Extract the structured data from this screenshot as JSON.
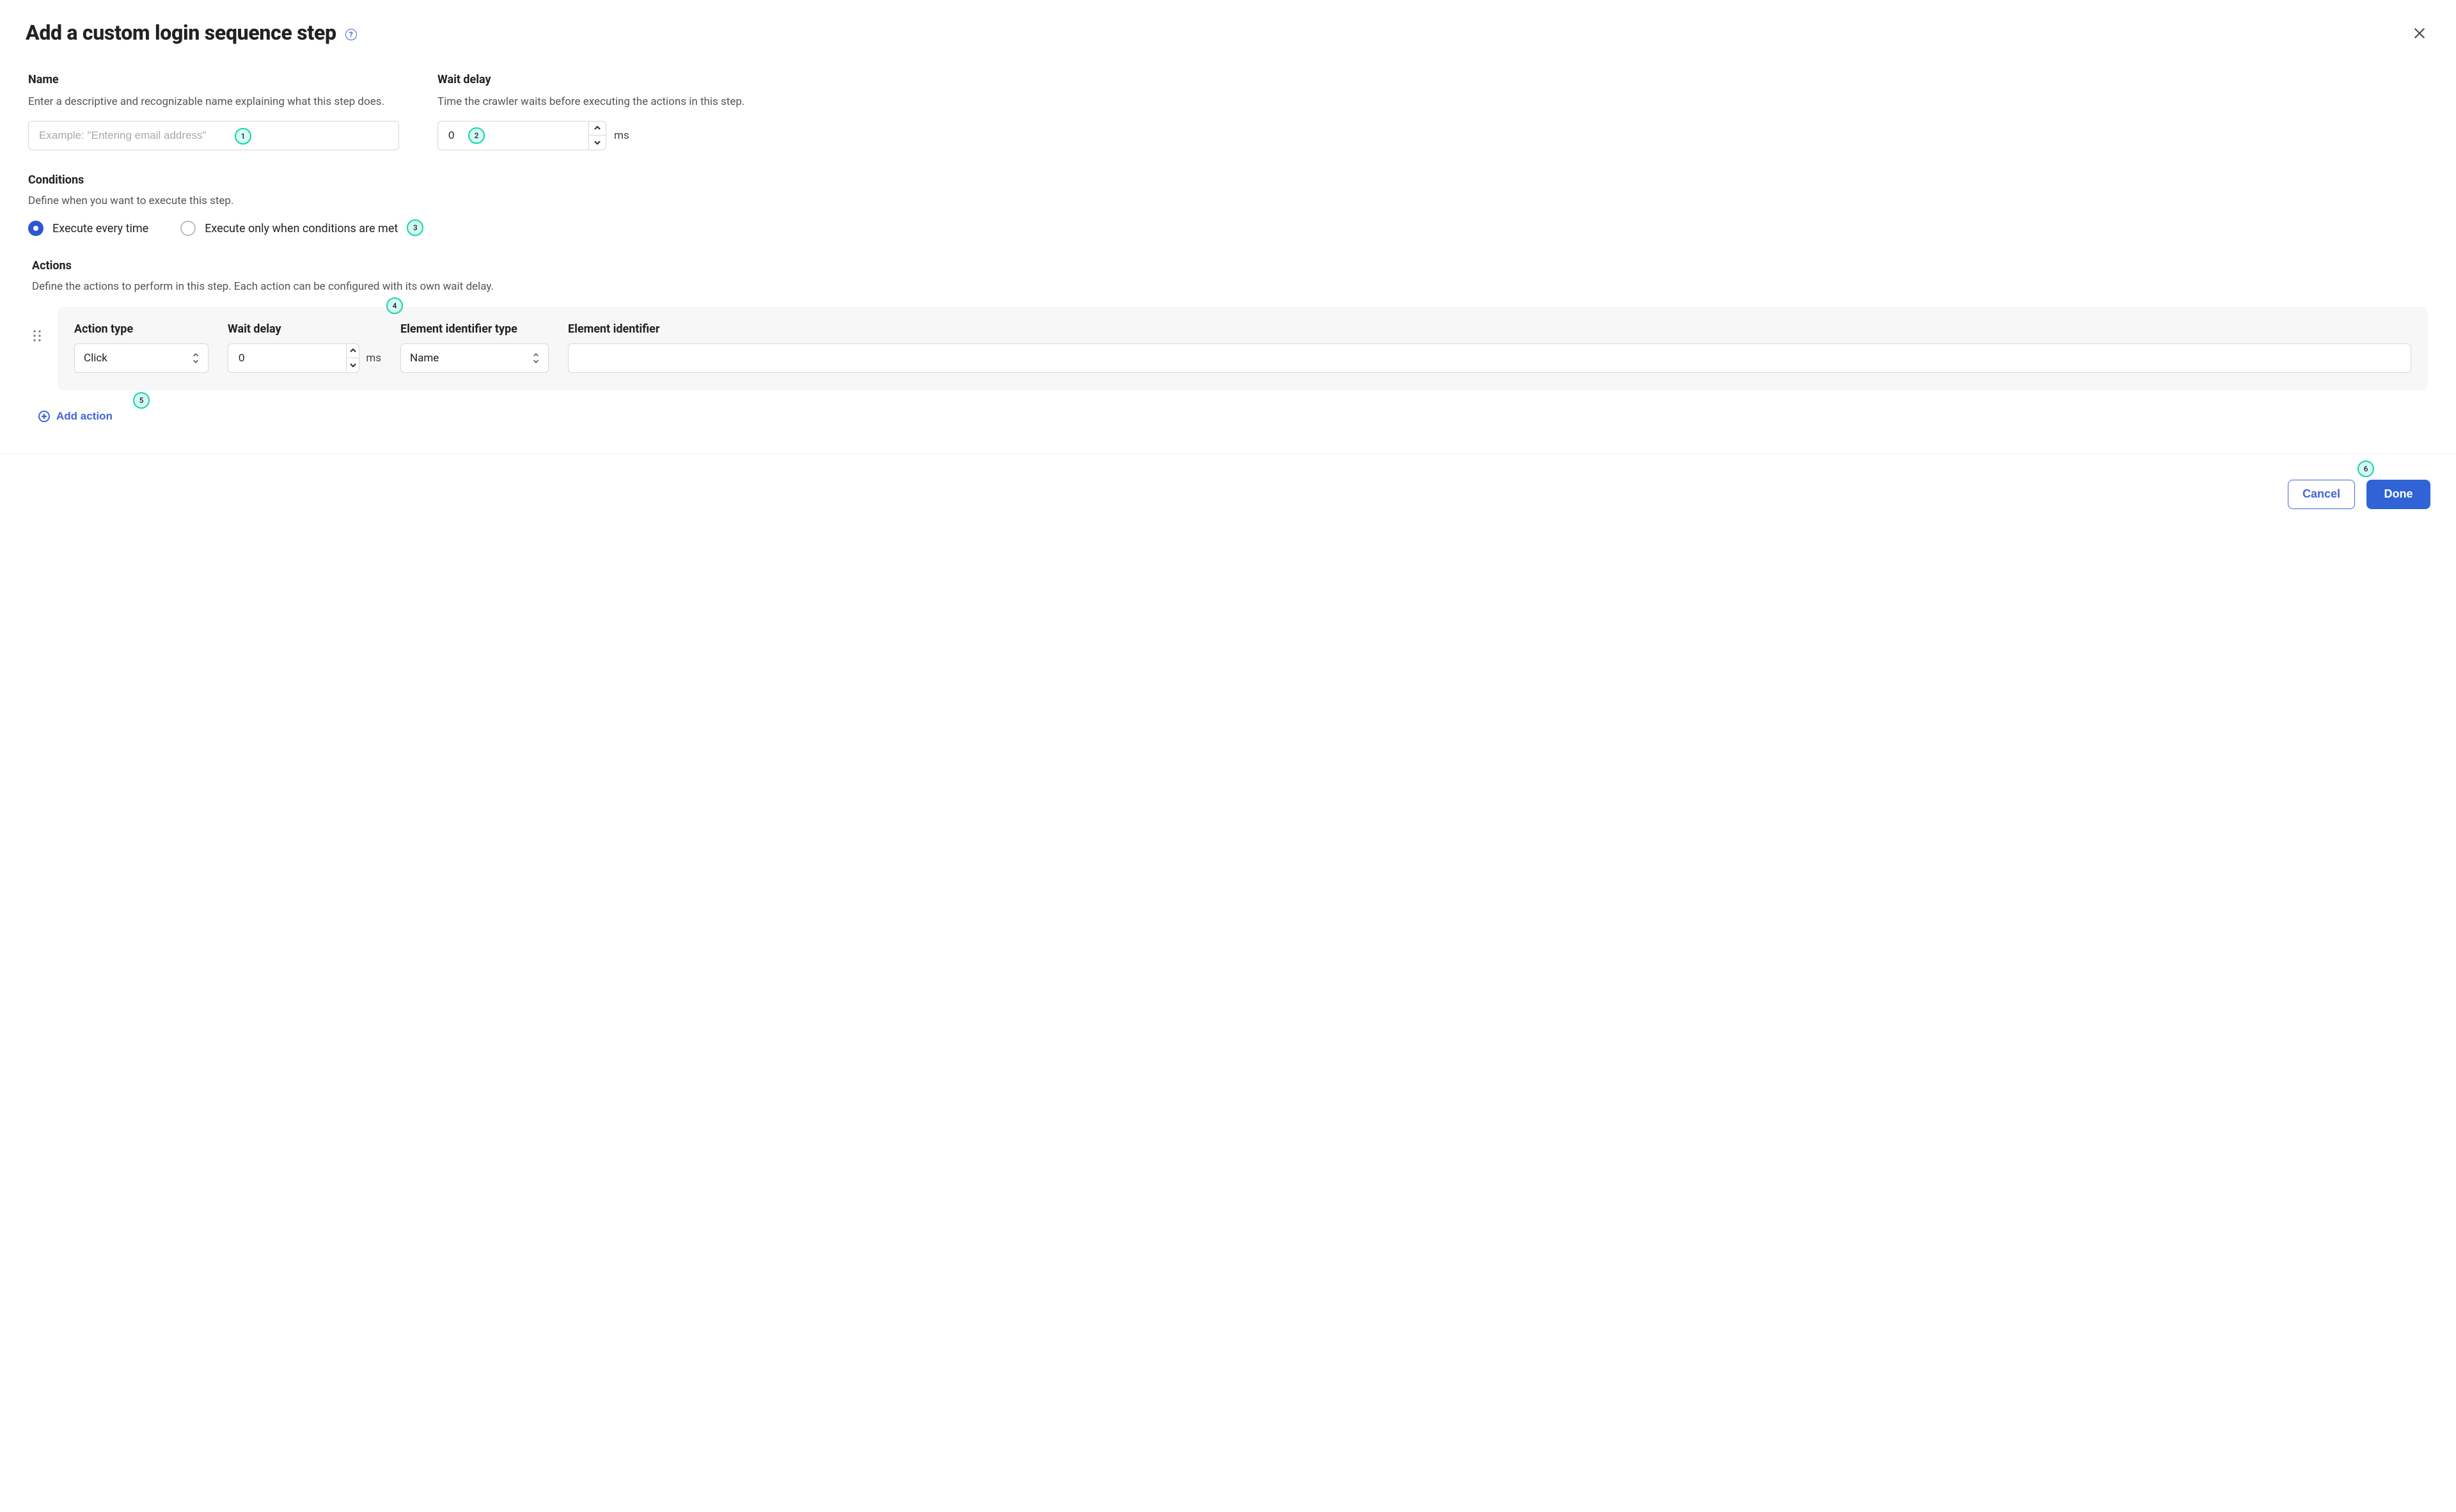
{
  "dialog": {
    "title": "Add a custom login sequence step"
  },
  "name": {
    "label": "Name",
    "hint": "Enter a descriptive and recognizable name explaining what this step does.",
    "placeholder": "Example: \"Entering email address\"",
    "value": ""
  },
  "wait_delay": {
    "label": "Wait delay",
    "hint": "Time the crawler waits before executing the actions in this step.",
    "value": "0",
    "unit": "ms"
  },
  "conditions": {
    "label": "Conditions",
    "hint": "Define when you want to execute this step.",
    "options": {
      "every": "Execute every time",
      "when": "Execute only when conditions are met"
    },
    "selected": "every"
  },
  "actions": {
    "label": "Actions",
    "hint": "Define the actions to perform in this step. Each action can be configured with its own wait delay.",
    "columns": {
      "type": "Action type",
      "wait": "Wait delay",
      "eltype": "Element identifier type",
      "elid": "Element identifier"
    },
    "row": {
      "type": "Click",
      "wait_value": "0",
      "wait_unit": "ms",
      "eltype": "Name",
      "elid": ""
    },
    "add_label": "Add action"
  },
  "footer": {
    "cancel": "Cancel",
    "done": "Done"
  },
  "hints": {
    "1": "1",
    "2": "2",
    "3": "3",
    "4": "4",
    "5": "5",
    "6": "6"
  },
  "icons": {
    "help": "help-icon",
    "close": "close-icon",
    "up": "chevron-up-icon",
    "down": "chevron-down-icon",
    "drag": "drag-handle-icon",
    "plus": "plus-circle-icon"
  }
}
